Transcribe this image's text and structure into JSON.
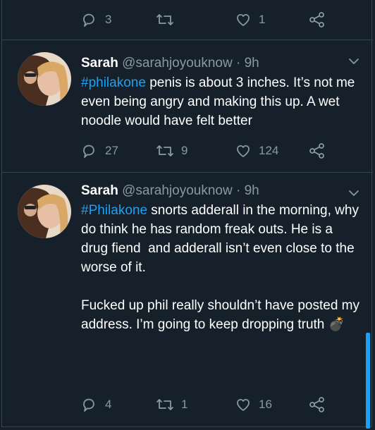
{
  "top_actions": {
    "replies": "3",
    "retweets": "",
    "likes": "1"
  },
  "tweets": [
    {
      "name": "Sarah",
      "handle": "@sarahjoyouknow",
      "separator": "·",
      "time": "9h",
      "hashtag": "#philakone",
      "text": " penis is about 3 inches. It’s not me even being angry and making this up. A wet noodle would have felt better",
      "replies": "27",
      "retweets": "9",
      "likes": "124"
    },
    {
      "name": "Sarah",
      "handle": "@sarahjoyouknow",
      "separator": "·",
      "time": "9h",
      "hashtag": "#Philakone",
      "text": " snorts adderall in the morning, why do think he has random freak outs. He is a drug fiend  and adderall isn’t even close to the worse of it.\n\nFucked up phil really shouldn’t have posted my address. I’m going to keep dropping truth ",
      "emoji": "💣",
      "replies": "4",
      "retweets": "1",
      "likes": "16"
    }
  ],
  "colors": {
    "background": "#15202b",
    "accent": "#1da1f2",
    "muted": "#8899a6",
    "border": "#38444d"
  },
  "icons": [
    "reply-icon",
    "retweet-icon",
    "like-icon",
    "share-icon",
    "chevron-down-icon"
  ]
}
